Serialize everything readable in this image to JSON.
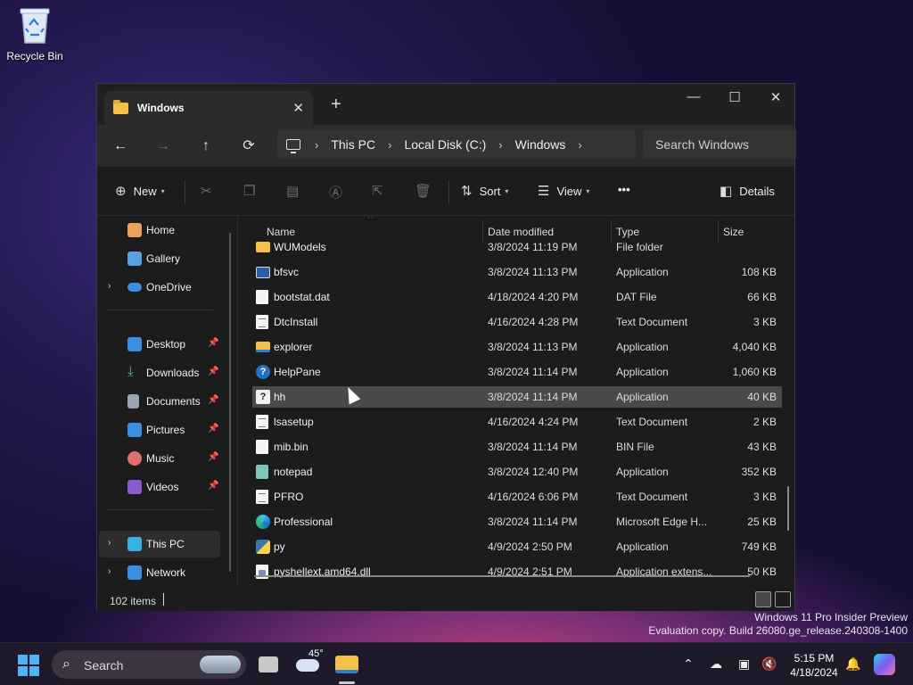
{
  "desktop": {
    "recycle_bin_label": "Recycle Bin",
    "watermark_line1": "Windows 11 Pro Insider Preview",
    "watermark_line2": "Evaluation copy. Build 26080.ge_release.240308-1400"
  },
  "window": {
    "tab_title": "Windows",
    "controls": {
      "minimize": "—",
      "maximize": "☐",
      "close": "✕"
    },
    "new_tab": "+",
    "tab_close": "✕"
  },
  "navbar": {
    "back": "←",
    "forward": "→",
    "up": "↑",
    "refresh": "⟳",
    "breadcrumbs": [
      "This PC",
      "Local Disk (C:)",
      "Windows"
    ],
    "separator": "›",
    "search_placeholder": "Search Windows"
  },
  "toolbar": {
    "new_label": "New",
    "sort_label": "Sort",
    "view_label": "View",
    "more_label": "•••",
    "details_label": "Details"
  },
  "sidebar": {
    "items": [
      {
        "label": "Home",
        "icon": "home-icon",
        "color": "#e8a25c"
      },
      {
        "label": "Gallery",
        "icon": "gallery-icon",
        "color": "#5aa0e0"
      },
      {
        "label": "OneDrive",
        "icon": "cloud-icon",
        "color": "#3b8ee0"
      },
      {
        "label": "Desktop",
        "icon": "desktop-icon",
        "color": "#3b8ee0"
      },
      {
        "label": "Downloads",
        "icon": "download-icon",
        "color": "#4cc38a"
      },
      {
        "label": "Documents",
        "icon": "document-icon",
        "color": "#9aa4b4"
      },
      {
        "label": "Pictures",
        "icon": "picture-icon",
        "color": "#3b8ee0"
      },
      {
        "label": "Music",
        "icon": "music-icon",
        "color": "#e07070"
      },
      {
        "label": "Videos",
        "icon": "video-icon",
        "color": "#8a5ad0"
      },
      {
        "label": "This PC",
        "icon": "computer-icon",
        "color": "#3bb0e0"
      },
      {
        "label": "Network",
        "icon": "network-icon",
        "color": "#3b8ee0"
      }
    ]
  },
  "columns": {
    "name": "Name",
    "date": "Date modified",
    "type": "Type",
    "size": "Size"
  },
  "files": [
    {
      "name": "WUModels",
      "date": "3/8/2024 11:19 PM",
      "type": "File folder",
      "size": ""
    },
    {
      "name": "bfsvc",
      "date": "3/8/2024 11:13 PM",
      "type": "Application",
      "size": "108 KB"
    },
    {
      "name": "bootstat.dat",
      "date": "4/18/2024 4:20 PM",
      "type": "DAT File",
      "size": "66 KB"
    },
    {
      "name": "DtcInstall",
      "date": "4/16/2024 4:28 PM",
      "type": "Text Document",
      "size": "3 KB"
    },
    {
      "name": "explorer",
      "date": "3/8/2024 11:13 PM",
      "type": "Application",
      "size": "4,040 KB"
    },
    {
      "name": "HelpPane",
      "date": "3/8/2024 11:14 PM",
      "type": "Application",
      "size": "1,060 KB"
    },
    {
      "name": "hh",
      "date": "3/8/2024 11:14 PM",
      "type": "Application",
      "size": "40 KB"
    },
    {
      "name": "lsasetup",
      "date": "4/16/2024 4:24 PM",
      "type": "Text Document",
      "size": "2 KB"
    },
    {
      "name": "mib.bin",
      "date": "3/8/2024 11:14 PM",
      "type": "BIN File",
      "size": "43 KB"
    },
    {
      "name": "notepad",
      "date": "3/8/2024 12:40 PM",
      "type": "Application",
      "size": "352 KB"
    },
    {
      "name": "PFRO",
      "date": "4/16/2024 6:06 PM",
      "type": "Text Document",
      "size": "3 KB"
    },
    {
      "name": "Professional",
      "date": "3/8/2024 11:14 PM",
      "type": "Microsoft Edge H...",
      "size": "25 KB"
    },
    {
      "name": "py",
      "date": "4/9/2024 2:50 PM",
      "type": "Application",
      "size": "749 KB"
    },
    {
      "name": "pyshellext.amd64.dll",
      "date": "4/9/2024 2:51 PM",
      "type": "Application extens...",
      "size": "50 KB"
    }
  ],
  "status": {
    "item_count": "102 items"
  },
  "taskbar": {
    "search_label": "Search",
    "weather_temp": "45°",
    "time": "5:15 PM",
    "date": "4/18/2024"
  }
}
